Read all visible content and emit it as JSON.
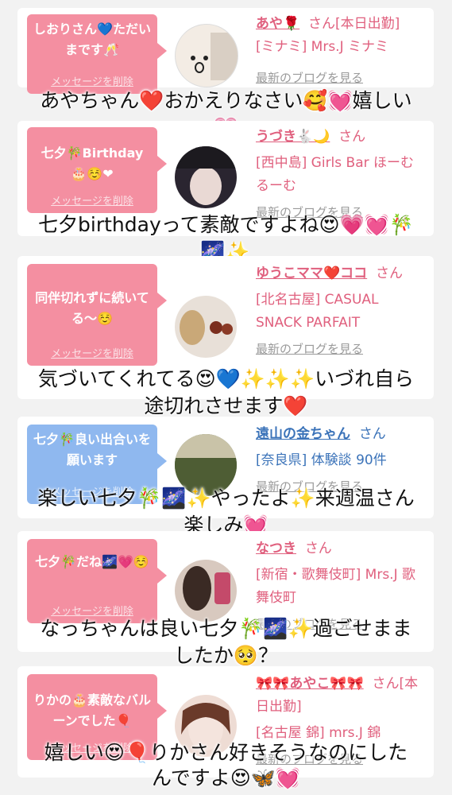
{
  "entries": [
    {
      "bubble": "しおりさん💙ただいまです🥂",
      "delete_label": "メッセージを削除",
      "name": "あや🌹",
      "san": "さん",
      "extra": "[本日出勤]",
      "shop": "[ミナミ] Mrs.J ミナミ",
      "blog": "最新のブログを見る",
      "caption_1": "あやちゃん❤️おかえりなさい🥰💓嬉しい",
      "caption_2": "💗"
    },
    {
      "bubble": "七夕🎋Birthday🎂☺️❤",
      "delete_label": "メッセージを削除",
      "name": "うづき🐇🌙",
      "san": "さん",
      "shop": "[西中島] Girls Bar ほーむるーむ",
      "blog": "最新のブログを見る",
      "caption_1": "七夕birthdayって素敵ですよね😍💗💓🎋",
      "caption_2": "🌌✨"
    },
    {
      "bubble": "同伴切れずに続いてる〜☺️",
      "delete_label": "メッセージを削除",
      "name": "ゆうこママ❤️ココ",
      "san": "さん",
      "shop": "[北名古屋] CASUAL SNACK PARFAIT",
      "blog": "最新のブログを見る",
      "caption_1": "気づいてくれてる😍💙✨✨✨いづれ自ら",
      "caption_2": "途切れさせます❤️"
    },
    {
      "bubble": "七夕🎋良い出合いを願います",
      "delete_label": "メッセージを削除",
      "name": "遠山の金ちゃん",
      "san": "さん",
      "shop": "[奈良県] 体験談 90件",
      "blog": "最新のブログを見る",
      "caption_1": "楽しい七夕🎋🌌✨やったよ✨来週温さん",
      "caption_2": "楽しみ💓"
    },
    {
      "bubble": "七夕🎋だね🌌💗☺️",
      "delete_label": "メッセージを削除",
      "name": "なつき",
      "san": "さん",
      "shop": "[新宿・歌舞伎町] Mrs.J 歌舞伎町",
      "blog": "最新のブログを見る",
      "caption_1": "なっちゃんは良い七夕🎋🌌✨過ごせまま",
      "caption_2": "したか🥺？"
    },
    {
      "bubble": "りかの🎂素敵なバルーンでした🎈",
      "delete_label": "メッセージを削除",
      "name": "🎀🎀あやこ🎀🎀",
      "san": "さん",
      "extra": "[本日出勤]",
      "shop": "[名古屋 錦] mrs.J 錦",
      "blog": "最新のブログを見る",
      "caption_1": "嬉しい😍🎈りかさん好きそうなのにした",
      "caption_2": "んですよ😍🦋💓"
    }
  ]
}
